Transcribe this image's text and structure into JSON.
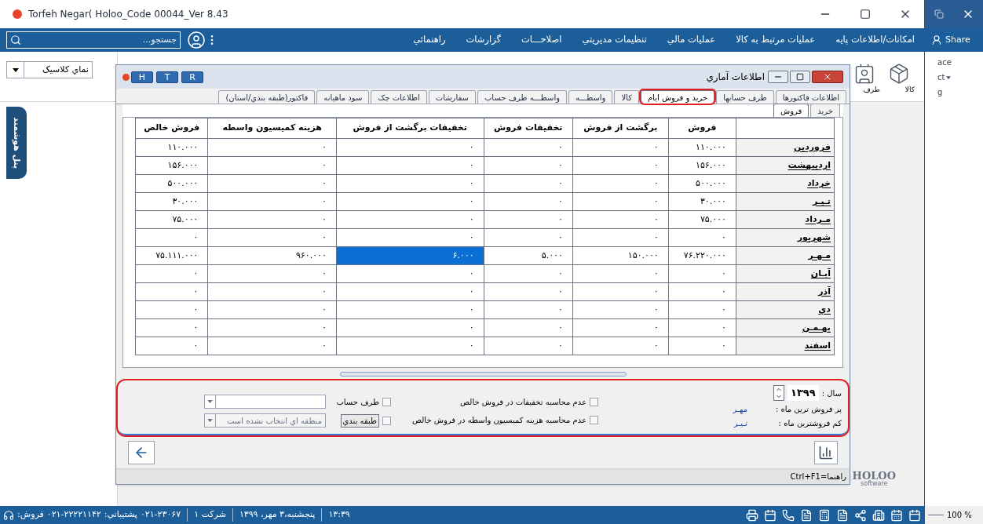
{
  "window": {
    "title": "Torfeh Negar( Holoo_Code 00044_Ver 8.43"
  },
  "search": {
    "placeholder": "جستجو..."
  },
  "menu_items": [
    "امکانات/اطلاعات پايه",
    "عمليات مرتبط به کالا",
    "عمليات مالي",
    "تنظيمات مديريتي",
    "اصلاحـــات",
    "گزارشات",
    "راهنمائي"
  ],
  "ribbon": {
    "view_select": "نماي کلاسيک",
    "buttons": [
      "کالا",
      "طرف"
    ]
  },
  "side_panel": {
    "label": "پنل هوشمند"
  },
  "dialog": {
    "title": "اطلاعات آماري",
    "hint_buttons": [
      "R",
      "T",
      "H"
    ],
    "tabs": [
      {
        "label": "اطلاعات فاکتورها",
        "selected": false,
        "highlighted": false
      },
      {
        "label": "طرف حسابها",
        "selected": false,
        "highlighted": false
      },
      {
        "label": "خريد و فروش ايام",
        "selected": true,
        "highlighted": true
      },
      {
        "label": "کالا",
        "selected": false,
        "highlighted": false
      },
      {
        "label": "واسطـــه",
        "selected": false,
        "highlighted": false
      },
      {
        "label": "واسطـــه طرف حساب",
        "selected": false,
        "highlighted": false
      },
      {
        "label": "سفارشات",
        "selected": false,
        "highlighted": false
      },
      {
        "label": "اطلاعات چک",
        "selected": false,
        "highlighted": false
      },
      {
        "label": "سود ماهيانه",
        "selected": false,
        "highlighted": false
      },
      {
        "label": "فاکتور(طبقه بندي/استان)",
        "selected": false,
        "highlighted": false
      }
    ],
    "subtabs": [
      {
        "label": "خريد",
        "selected": false
      },
      {
        "label": "فروش",
        "selected": true
      }
    ],
    "table": {
      "columns": [
        "فروش",
        "برگشت از فروش",
        "تخفيفات فروش",
        "تخفيفات برگشت از فروش",
        "هزينه کميسيون واسطه",
        "فروش خالص"
      ],
      "rows": [
        {
          "month": "فروردين",
          "cells": [
            {
              "text": "۱۱۰.۰۰۰",
              "selected": false
            },
            {
              "text": "۰",
              "selected": false
            },
            {
              "text": "۰",
              "selected": false
            },
            {
              "text": "۰",
              "selected": false
            },
            {
              "text": "۰",
              "selected": false
            },
            {
              "text": "۱۱۰.۰۰۰",
              "selected": false
            }
          ]
        },
        {
          "month": "ارديبهشت",
          "cells": [
            {
              "text": "۱۵۶.۰۰۰",
              "selected": false
            },
            {
              "text": "۰",
              "selected": false
            },
            {
              "text": "۰",
              "selected": false
            },
            {
              "text": "۰",
              "selected": false
            },
            {
              "text": "۰",
              "selected": false
            },
            {
              "text": "۱۵۶.۰۰۰",
              "selected": false
            }
          ]
        },
        {
          "month": "خرداد",
          "cells": [
            {
              "text": "۵۰۰.۰۰۰",
              "selected": false
            },
            {
              "text": "۰",
              "selected": false
            },
            {
              "text": "۰",
              "selected": false
            },
            {
              "text": "۰",
              "selected": false
            },
            {
              "text": "۰",
              "selected": false
            },
            {
              "text": "۵۰۰.۰۰۰",
              "selected": false
            }
          ]
        },
        {
          "month": "تـيـر",
          "cells": [
            {
              "text": "۳۰.۰۰۰",
              "selected": false
            },
            {
              "text": "۰",
              "selected": false
            },
            {
              "text": "۰",
              "selected": false
            },
            {
              "text": "۰",
              "selected": false
            },
            {
              "text": "۰",
              "selected": false
            },
            {
              "text": "۳۰.۰۰۰",
              "selected": false
            }
          ]
        },
        {
          "month": "مـرداد",
          "cells": [
            {
              "text": "۷۵.۰۰۰",
              "selected": false
            },
            {
              "text": "۰",
              "selected": false
            },
            {
              "text": "۰",
              "selected": false
            },
            {
              "text": "۰",
              "selected": false
            },
            {
              "text": "۰",
              "selected": false
            },
            {
              "text": "۷۵.۰۰۰",
              "selected": false
            }
          ]
        },
        {
          "month": "شهريور",
          "cells": [
            {
              "text": "۰",
              "selected": false
            },
            {
              "text": "۰",
              "selected": false
            },
            {
              "text": "۰",
              "selected": false
            },
            {
              "text": "۰",
              "selected": false
            },
            {
              "text": "۰",
              "selected": false
            },
            {
              "text": "۰",
              "selected": false
            }
          ]
        },
        {
          "month": "مـهـر",
          "cells": [
            {
              "text": "۷۶.۲۲۰.۰۰۰",
              "selected": false
            },
            {
              "text": "۱۵۰.۰۰۰",
              "selected": false
            },
            {
              "text": "۵.۰۰۰",
              "selected": false
            },
            {
              "text": "۶.۰۰۰",
              "selected": true
            },
            {
              "text": "۹۶۰.۰۰۰",
              "selected": false
            },
            {
              "text": "۷۵.۱۱۱.۰۰۰",
              "selected": false
            }
          ]
        },
        {
          "month": "آبـان",
          "cells": [
            {
              "text": "۰",
              "selected": false
            },
            {
              "text": "۰",
              "selected": false
            },
            {
              "text": "۰",
              "selected": false
            },
            {
              "text": "۰",
              "selected": false
            },
            {
              "text": "۰",
              "selected": false
            },
            {
              "text": "۰",
              "selected": false
            }
          ]
        },
        {
          "month": "آذر",
          "cells": [
            {
              "text": "۰",
              "selected": false
            },
            {
              "text": "۰",
              "selected": false
            },
            {
              "text": "۰",
              "selected": false
            },
            {
              "text": "۰",
              "selected": false
            },
            {
              "text": "۰",
              "selected": false
            },
            {
              "text": "۰",
              "selected": false
            }
          ]
        },
        {
          "month": "دي",
          "cells": [
            {
              "text": "۰",
              "selected": false
            },
            {
              "text": "۰",
              "selected": false
            },
            {
              "text": "۰",
              "selected": false
            },
            {
              "text": "۰",
              "selected": false
            },
            {
              "text": "۰",
              "selected": false
            },
            {
              "text": "۰",
              "selected": false
            }
          ]
        },
        {
          "month": "بهـمـن",
          "cells": [
            {
              "text": "۰",
              "selected": false
            },
            {
              "text": "۰",
              "selected": false
            },
            {
              "text": "۰",
              "selected": false
            },
            {
              "text": "۰",
              "selected": false
            },
            {
              "text": "۰",
              "selected": false
            },
            {
              "text": "۰",
              "selected": false
            }
          ]
        },
        {
          "month": "اسفند",
          "cells": [
            {
              "text": "۰",
              "selected": false
            },
            {
              "text": "۰",
              "selected": false
            },
            {
              "text": "۰",
              "selected": false
            },
            {
              "text": "۰",
              "selected": false
            },
            {
              "text": "۰",
              "selected": false
            },
            {
              "text": "۰",
              "selected": false
            }
          ]
        }
      ]
    },
    "options": {
      "highlighted": true,
      "year_label": "سال :",
      "year": "۱۳۹۹",
      "best_label": "پر فروش ترين ماه :",
      "best_value": "مهـر",
      "worst_label": "کم فروشترين ماه :",
      "worst_value": "تـيـر",
      "checkboxes": [
        {
          "label": "عدم محاسبه تخفيفات در فروش خالص",
          "checked": false
        },
        {
          "label": "عدم محاسبه هزينه کميسيون واسطه در فروش خالص",
          "checked": false
        }
      ],
      "account": {
        "label": "طرف حساب",
        "checked": false
      },
      "category": {
        "label": "طبقه بندي",
        "checked": false,
        "value": "منطقه اي انتخاب نشده است",
        "disabled": true
      }
    },
    "footer": "Ctrl+F1=راهنما"
  },
  "logo": {
    "name": "HOLOO",
    "tagline": "software"
  },
  "status_bar": {
    "clock": "۱۳:۳۹",
    "date": "پنجشنبه،۳ مهر، ۱۳۹۹",
    "company": "شرکت ۱",
    "phones": [
      "۰۲۱-۲۳۰۶۷",
      "پشتيباني:",
      "۰۲۱-۲۲۲۲۱۱۴۲",
      "فروش:"
    ]
  },
  "side_window": {
    "share": "Share",
    "texts": [
      "ace",
      "ct",
      "g"
    ],
    "zoom": "100 %"
  }
}
